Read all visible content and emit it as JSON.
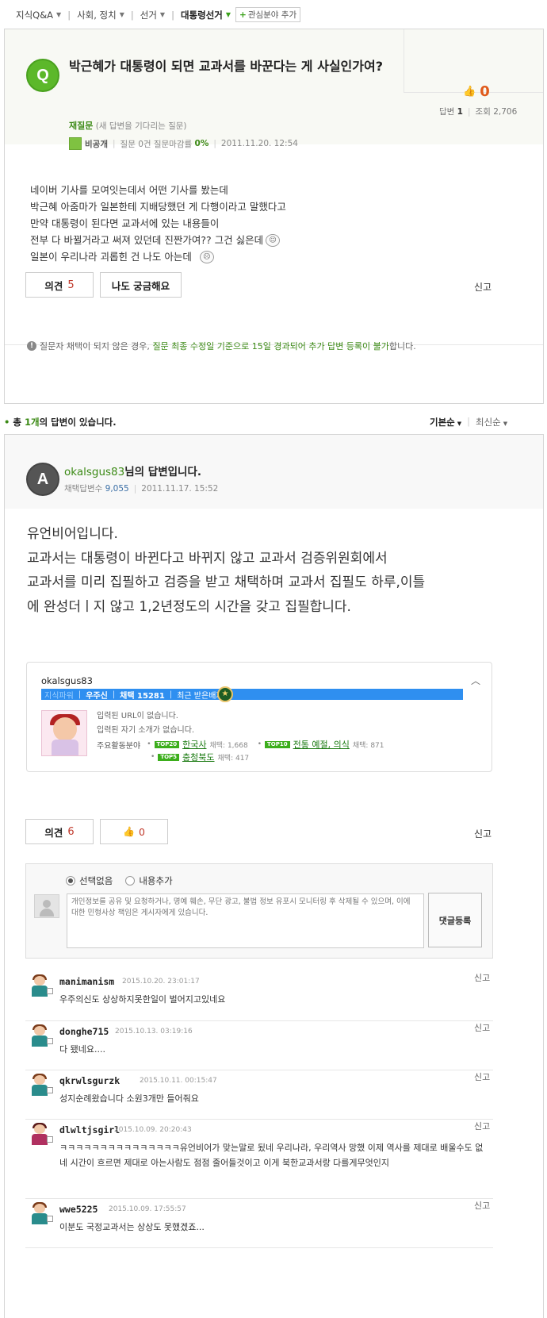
{
  "breadcrumb": {
    "items": [
      "지식Q&A",
      "사회, 정치",
      "선거",
      "대통령선거"
    ],
    "add_interest": "관심분야 추가"
  },
  "question": {
    "badge": "Q",
    "title": "박근혜가 대통령이 되면 교과서를 바꾼다는 게 사실인가여?",
    "requestion_label": "재질문",
    "requestion_note": "(새 답변을 기다리는 질문)",
    "author": "비공개",
    "question_stat": "질문 0건 질문마감률",
    "close_rate": "0%",
    "date": "2011.11.20. 12:54",
    "like_count": "0",
    "answers_label": "답변",
    "answers_count": "1",
    "views_label": "조회",
    "views_count": "2,706",
    "body": [
      "네이버 기사를 모여잇는데서 어떤 기사를 봤는데",
      "박근혜 아줌마가 일본한테 지배당했던 게 다행이라고 말했다고",
      "만약 대통령이 된다면 교과서에 있는 내용들이",
      "전부 다 바뀔거라고 써져 있던데 진짠가여?? 그건 싫은데",
      "일본이 우리나라 괴롭힌 건 나도 아는데"
    ],
    "opinion_label": "의견",
    "opinion_count": "5",
    "curious_label": "나도 궁금해요",
    "report_label": "신고",
    "notice_pre": "질문자 채택이 되지 않은 경우,",
    "notice_green": "질문 최종 수정일 기준으로 15일 경과되어 추가 답변 등록이 불가",
    "notice_post": "합니다."
  },
  "answers_header": {
    "pre": "총",
    "count": "1개",
    "post": "의 답변이 있습니다.",
    "sort_default": "기본순",
    "sort_recent": "최신순"
  },
  "answer": {
    "badge": "A",
    "username": "okalsgus83",
    "name_suffix": "님의 답변입니다.",
    "adopted_label": "채택답변수",
    "adopted_count": "9,055",
    "date": "2011.11.17. 15:52",
    "body": [
      "유언비어입니다.",
      "교과서는 대통령이 바뀐다고 바뀌지 않고 교과서 검증위원회에서",
      "교과서를 미리 집필하고 검증을 받고 채택하며 교과서 집필도 하루,이틀",
      "에 완성더ㅣ지 않고 1,2년정도의 시간을 갖고 집필합니다."
    ],
    "profile": {
      "user_id": "okalsgus83",
      "level_label": "지식파워",
      "level": "우주신",
      "adopt_label": "채택 15281",
      "recent_badge": "최근 받은배지",
      "no_url": "입력된 URL이 없습니다.",
      "no_intro": "입력된 자기 소개가 없습니다.",
      "fields_label": "주요활동분야",
      "fields": [
        {
          "tag": "TOP20",
          "name": "한국사",
          "count": "채택: 1,668"
        },
        {
          "tag": "TOP10",
          "name": "전통 예절, 의식",
          "count": "채택: 871"
        },
        {
          "tag": "TOP5",
          "name": "충청북도",
          "count": "채택: 417"
        }
      ]
    },
    "opinion_label": "의견",
    "opinion_count": "6",
    "like_count": "0",
    "report_label": "신고"
  },
  "comment_form": {
    "radio_none": "선택없음",
    "radio_add": "내용추가",
    "placeholder": "개인정보를 공유 및 요청하거나, 명예 훼손, 무단 광고, 불법 정보 유포시 모니터링 후 삭제될 수 있으며, 이에 대한 민형사상 책임은 게시자에게 있습니다.",
    "submit": "댓글등록"
  },
  "comments": [
    {
      "user": "manimanism",
      "time": "2015.10.20. 23:01:17",
      "text": "우주의신도 상상하지못한일이 벌어지고있네요",
      "report": "신고"
    },
    {
      "user": "donghe715",
      "time": "2015.10.13. 03:19:16",
      "text": "다 됐네요....",
      "report": "신고"
    },
    {
      "user": "qkrwlsgurzk",
      "time": "2015.10.11. 00:15:47",
      "text": "성지순례왔습니다 소원3개만 들어줘요",
      "report": "신고"
    },
    {
      "user": "dlwltjsgirl",
      "time": "2015.10.09. 20:20:43",
      "text": "ㅋㅋㅋㅋㅋㅋㅋㅋㅋㅋㅋㅋㅋㅋㅋ유언비어가 맞는말로 됬네 우리나라, 우리역사 망했 이제 역사를 제대로 배울수도 없네 시간이 흐르면 제대로 아는사람도 점점 줄어들것이고 이게 북한교과서랑 다를게무엇인지",
      "report": "신고"
    },
    {
      "user": "wwe5225",
      "time": "2015.10.09. 17:55:57",
      "text": "이분도 국정교과서는 상상도 못했겠죠...",
      "report": "신고"
    }
  ]
}
